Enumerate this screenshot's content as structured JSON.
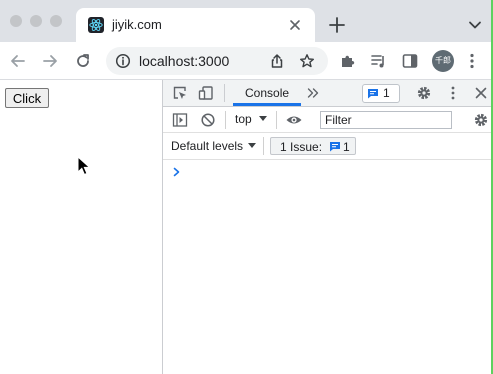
{
  "browser": {
    "tab": {
      "title": "jiyik.com"
    },
    "address_bar": {
      "url": "localhost:3000"
    },
    "profile": {
      "avatar_text": "千郎"
    }
  },
  "page": {
    "button_label": "Click"
  },
  "devtools": {
    "tabs": {
      "console_label": "Console"
    },
    "issues_badge_count": "1",
    "toolbar": {
      "context": "top",
      "filter_placeholder": "Filter"
    },
    "levels": {
      "label": "Default levels",
      "issue_label": "1 Issue:",
      "issue_count": "1"
    }
  },
  "colors": {
    "accent": "#1a73e8",
    "tabstrip": "#dee1e6",
    "devtools_bg": "#f1f3f4"
  }
}
